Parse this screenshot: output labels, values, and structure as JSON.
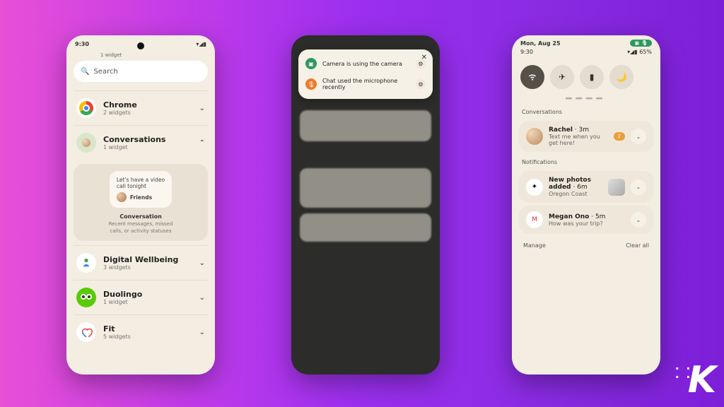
{
  "phone1": {
    "time": "9:30",
    "cut_app": "1 widget",
    "search_placeholder": "Search",
    "items": [
      {
        "name": "Chrome",
        "sub": "2 widgets"
      },
      {
        "name": "Conversations",
        "sub": "1 widget"
      },
      {
        "name": "Digital Wellbeing",
        "sub": "3 widgets"
      },
      {
        "name": "Duolingo",
        "sub": "1 widget"
      },
      {
        "name": "Fit",
        "sub": "5 widgets"
      }
    ],
    "expanded": {
      "bubble1": "Let's have a video",
      "bubble2": "call tonight",
      "bubble_from": "Friends",
      "label": "Conversation",
      "desc1": "Recent messages, missed",
      "desc2": "calls, or activity statuses"
    }
  },
  "phone2": {
    "alerts": [
      {
        "text": "Camera is using the camera",
        "color": "#2e9760",
        "glyph": "📷"
      },
      {
        "text": "Chat used the microphone recently",
        "color": "#e87c2e",
        "glyph": "🎤"
      }
    ]
  },
  "phone3": {
    "date": "Mon, Aug 25",
    "time": "9:30",
    "battery": "65%",
    "sections": {
      "conversations": "Conversations",
      "notifications": "Notifications"
    },
    "conv": {
      "name": "Rachel",
      "meta": "3m",
      "body": "Text me when you get here!",
      "count": "2"
    },
    "notifs": [
      {
        "title": "New photos added",
        "meta": "6m",
        "body": "Oregon Coast"
      },
      {
        "title": "Megan Ono",
        "meta": "5m",
        "body": "How was your trip?"
      }
    ],
    "manage": "Manage",
    "clear": "Clear all"
  }
}
